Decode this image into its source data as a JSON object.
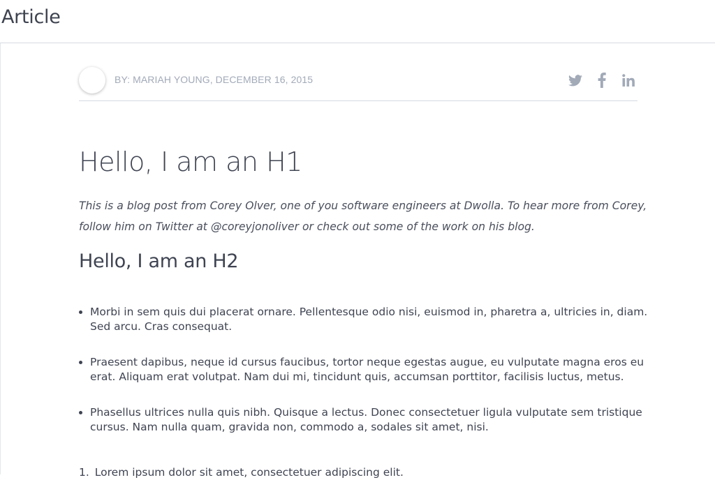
{
  "header": {
    "title": "Article"
  },
  "meta": {
    "byline": "BY: MARIAH YOUNG, DECEMBER 16, 2015",
    "social": [
      {
        "icon": "twitter-icon",
        "label": "Twitter"
      },
      {
        "icon": "facebook-icon",
        "label": "Facebook"
      },
      {
        "icon": "linkedin-icon",
        "label": "LinkedIn"
      }
    ]
  },
  "article": {
    "h1": "Hello, I am an H1",
    "intro_lines": [
      "This is a blog post from Corey Olver, one of you software engineers at Dwolla. To hear more from Corey,",
      "follow him on Twitter at @coreyjonoliver or check out some of the work on his blog."
    ],
    "h2": "Hello, I am an H2",
    "bullets": [
      [
        "Morbi in sem quis dui placerat ornare. Pellentesque odio nisi, euismod in, pharetra a, ultricies in, diam.",
        "Sed arcu. Cras consequat."
      ],
      [
        "Praesent dapibus, neque id cursus faucibus, tortor neque egestas augue, eu vulputate magna eros eu",
        "erat. Aliquam erat volutpat. Nam dui mi, tincidunt quis, accumsan porttitor, facilisis luctus, metus."
      ],
      [
        "Phasellus ultrices nulla quis nibh. Quisque a lectus. Donec consectetuer ligula vulputate sem tristique",
        "cursus. Nam nulla quam, gravida non, commodo a, sodales sit amet, nisi."
      ]
    ],
    "ordered": [
      {
        "num": "1.",
        "text": "Lorem ipsum dolor sit amet, consectetuer adipiscing elit."
      }
    ]
  },
  "colors": {
    "text": "#3f4452",
    "muted": "#a2aab8",
    "rule": "#d5dae1"
  }
}
